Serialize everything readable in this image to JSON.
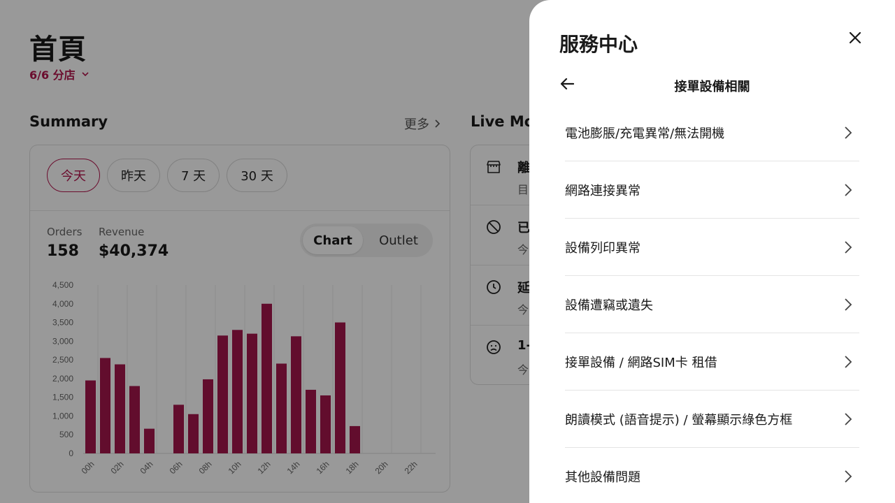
{
  "page": {
    "title": "首頁",
    "store_selector": "6/6 分店"
  },
  "summary": {
    "title": "Summary",
    "more_label": "更多",
    "period_tabs": [
      "今天",
      "昨天",
      "7 天",
      "30 天"
    ],
    "active_tab": "今天",
    "orders_label": "Orders",
    "orders_value": "158",
    "revenue_label": "Revenue",
    "revenue_value": "$40,374",
    "view_toggle": [
      "Chart",
      "Outlet"
    ],
    "active_view": "Chart"
  },
  "chart_data": {
    "type": "bar",
    "categories": [
      "00h",
      "01h",
      "02h",
      "03h",
      "04h",
      "05h",
      "06h",
      "07h",
      "08h",
      "09h",
      "10h",
      "11h",
      "12h",
      "13h",
      "14h",
      "15h",
      "16h",
      "17h",
      "18h",
      "19h",
      "20h",
      "21h",
      "22h",
      "23h"
    ],
    "tick_labels": [
      "00h",
      "02h",
      "04h",
      "06h",
      "08h",
      "10h",
      "12h",
      "14h",
      "16h",
      "18h",
      "20h",
      "22h"
    ],
    "values": [
      1950,
      2550,
      2380,
      1800,
      660,
      0,
      1300,
      1050,
      1980,
      3150,
      3300,
      3200,
      4000,
      2400,
      3130,
      1700,
      1550,
      3500,
      730,
      0,
      0,
      0,
      0,
      0
    ],
    "y_ticks": [
      "0",
      "500",
      "1,000",
      "1,500",
      "2,000",
      "2,500",
      "3,000",
      "3,500",
      "4,000",
      "4,500"
    ],
    "ylim": [
      0,
      4500
    ],
    "grid": true,
    "bar_color": "#a3164c"
  },
  "live": {
    "title": "Live Mo",
    "rows": [
      {
        "icon": "store-icon",
        "line1": "離",
        "line2": "目"
      },
      {
        "icon": "block-icon",
        "line1": "已",
        "line2": "今"
      },
      {
        "icon": "clock-icon",
        "line1": "延",
        "line2": "今"
      },
      {
        "icon": "sad-face-icon",
        "line1": "1-",
        "line2": "今"
      }
    ]
  },
  "panel": {
    "title": "服務中心",
    "subtitle": "接單設備相關",
    "items": [
      {
        "label": "電池膨脹/充電異常/無法開機"
      },
      {
        "label": "網路連接異常"
      },
      {
        "label": "設備列印異常"
      },
      {
        "label": "設備遭竊或遺失"
      },
      {
        "label": "接單設備 / 網路SIM卡 租借"
      },
      {
        "label": "朗讀模式 (語音提示) / 螢幕顯示綠色方框"
      },
      {
        "label": "其他設備問題"
      }
    ]
  },
  "colors": {
    "accent": "#b3164e",
    "overlay": "rgba(0,0,0,0.40)"
  }
}
